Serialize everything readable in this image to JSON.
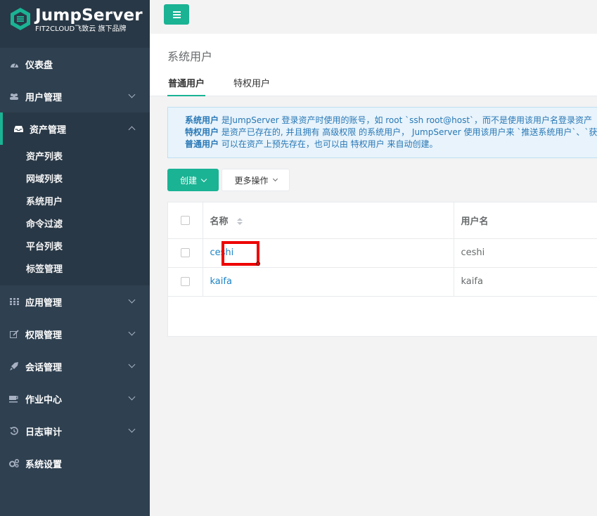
{
  "app": {
    "logo_title": "JumpServer",
    "logo_sub": "FIT2CLOUD飞致云 旗下品牌"
  },
  "sidebar": {
    "items": [
      {
        "label": "仪表盘",
        "icon": "dashboard-icon"
      },
      {
        "label": "用户管理",
        "icon": "users-icon"
      },
      {
        "label": "资产管理",
        "icon": "inbox-icon"
      },
      {
        "label": "应用管理",
        "icon": "apps-grid-icon"
      },
      {
        "label": "权限管理",
        "icon": "edit-icon"
      },
      {
        "label": "会话管理",
        "icon": "rocket-icon"
      },
      {
        "label": "作业中心",
        "icon": "coffee-icon"
      },
      {
        "label": "日志审计",
        "icon": "history-icon"
      },
      {
        "label": "系统设置",
        "icon": "gears-icon"
      }
    ],
    "asset_submenu": [
      "资产列表",
      "网域列表",
      "系统用户",
      "命令过滤",
      "平台列表",
      "标签管理"
    ]
  },
  "page": {
    "title": "系统用户",
    "tabs": [
      "普通用户",
      "特权用户"
    ]
  },
  "alert": {
    "l1_term": "系统用户",
    "l1_text": " 是JumpServer 登录资产时使用的账号，如 root `ssh root@host`，而不是使用该用户名登录资产（ssh",
    "l2_term": "特权用户",
    "l2_text": " 是资产已存在的, 并且拥有 高级权限 的系统用户， JumpServer 使用该用户来 `推送系统用户`、`获取资",
    "l3_term": "普通用户",
    "l3_text": " 可以在资产上预先存在，也可以由 特权用户 来自动创建。"
  },
  "toolbar": {
    "create_label": "创建",
    "more_label": "更多操作"
  },
  "table": {
    "headers": [
      "名称",
      "用户名"
    ],
    "rows": [
      {
        "name": "ceshi",
        "username": "ceshi"
      },
      {
        "name": "kaifa",
        "username": "kaifa"
      }
    ]
  },
  "colors": {
    "sidebar_bg": "#2f4050",
    "accent": "#1ab394",
    "link": "#1c84c6",
    "highlight": "#ee0000"
  }
}
